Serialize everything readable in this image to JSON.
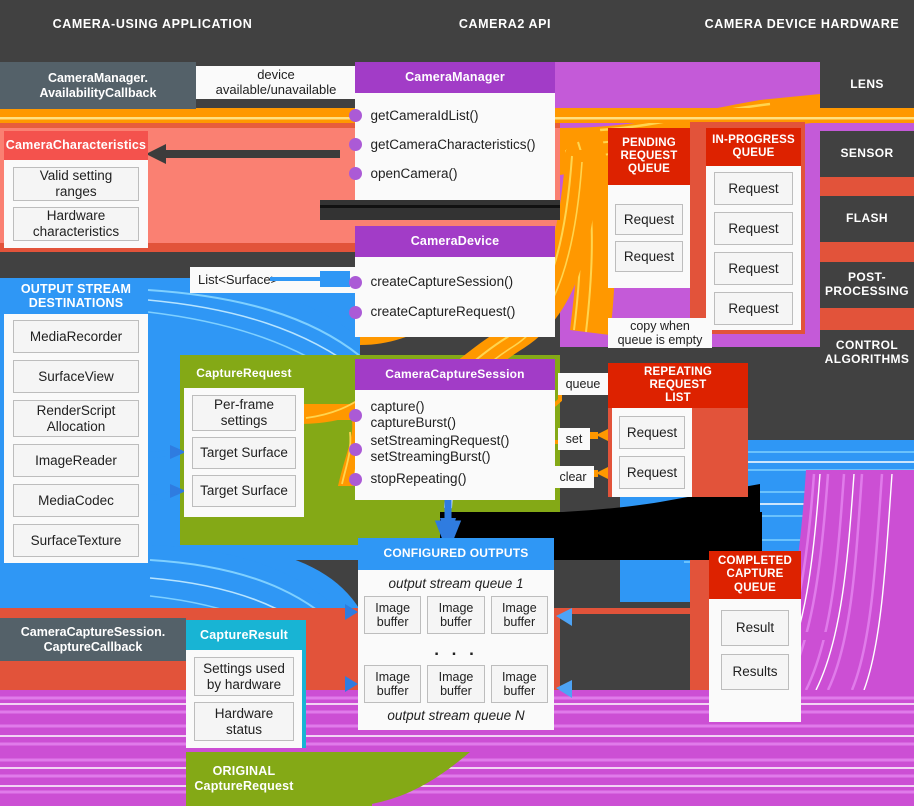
{
  "columns": [
    {
      "label": "CAMERA-USING APPLICATION"
    },
    {
      "label": "CAMERA2 API"
    },
    {
      "label": "CAMERA DEVICE HARDWARE"
    }
  ],
  "callbacks": {
    "availability": "CameraManager.\nAvailabilityCallback",
    "capture": "CameraCaptureSession.\nCaptureCallback"
  },
  "chips": {
    "device_availability": "device\navailable/unavailable",
    "list_surface": "List<Surface>",
    "copy_when_empty": "copy when\nqueue is empty",
    "queue": "queue",
    "set": "set",
    "clear": "clear"
  },
  "panels": {
    "camera_characteristics": {
      "title": "CameraCharacteristics",
      "items": [
        "Valid setting\nranges",
        "Hardware\ncharacteristics"
      ]
    },
    "output_stream_destinations": {
      "title": "OUTPUT STREAM\nDESTINATIONS",
      "items": [
        "MediaRecorder",
        "SurfaceView",
        "RenderScript\nAllocation",
        "ImageReader",
        "MediaCodec",
        "SurfaceTexture"
      ]
    },
    "camera_manager": {
      "title": "CameraManager",
      "methods": [
        "getCameraIdList()",
        "getCameraCharacteristics()",
        "openCamera()"
      ]
    },
    "camera_device": {
      "title": "CameraDevice",
      "methods": [
        "createCaptureSession()",
        "createCaptureRequest()"
      ]
    },
    "capture_request": {
      "title": "CaptureRequest",
      "items": [
        "Per-frame\nsettings",
        "Target Surface",
        "Target Surface"
      ]
    },
    "camera_capture_session": {
      "title": "CameraCaptureSession",
      "methods": [
        "capture()\ncaptureBurst()",
        "setStreamingRequest()\nsetStreamingBurst()",
        "stopRepeating()"
      ]
    },
    "pending_request_queue": {
      "title": "PENDING\nREQUEST\nQUEUE",
      "items": [
        "Request",
        "Request"
      ]
    },
    "in_progress_queue": {
      "title": "IN-PROGRESS\nQUEUE",
      "items": [
        "Request",
        "Request",
        "Request",
        "Request"
      ]
    },
    "repeating_request_list": {
      "title": "REPEATING\nREQUEST\nLIST",
      "items": [
        "Request",
        "Request"
      ]
    },
    "configured_outputs": {
      "title": "CONFIGURED OUTPUTS",
      "queue_first_label": "output stream queue 1",
      "queue_last_label": "output stream queue N",
      "ellipsis": ". . .",
      "buffers_first": [
        "Image\nbuffer",
        "Image\nbuffer",
        "Image\nbuffer"
      ],
      "buffers_last": [
        "Image\nbuffer",
        "Image\nbuffer",
        "Image\nbuffer"
      ]
    },
    "completed_capture_queue": {
      "title": "COMPLETED\nCAPTURE\nQUEUE",
      "items": [
        "Result",
        "Results"
      ]
    },
    "capture_result": {
      "title": "CaptureResult",
      "items": [
        "Settings used\nby hardware",
        "Hardware\nstatus"
      ]
    },
    "original_capture_request": {
      "title": "ORIGINAL\nCaptureRequest"
    }
  },
  "hardware": [
    {
      "label": "LENS"
    },
    {
      "label": "SENSOR"
    },
    {
      "label": "FLASH"
    },
    {
      "label": "POST-\nPROCESSING"
    },
    {
      "label": "CONTROL\nALGORITHMS"
    }
  ],
  "colors": {
    "background": "#414141",
    "purple": "#c45ad8",
    "purple_header": "#a23cc7",
    "orange": "#ff9800",
    "red": "#e2533a",
    "red_header": "#dd2200",
    "salmon": "#fa8072",
    "salmon_header": "#f4524d",
    "blue": "#2196f3",
    "blue_light": "#64b5f6",
    "green": "#84a916",
    "cyan": "#18b4d4",
    "slate": "#546169",
    "magenta": "#cc4fd4"
  }
}
